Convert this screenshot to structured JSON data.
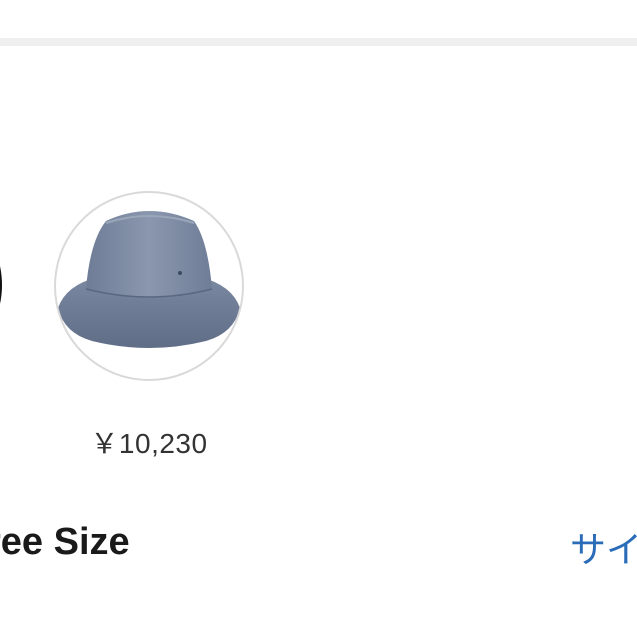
{
  "product": {
    "color_options": [
      {
        "state": "selected"
      },
      {
        "icon": "bucket-hat-icon",
        "color": "#7d8aa3",
        "price": "￥10,230"
      }
    ],
    "size": {
      "value": "ree Size",
      "guide_link": "サイ"
    }
  },
  "colors": {
    "link": "#2b6cb8",
    "hat_blue_gray": "#7d8aa3",
    "selected_ring": "#111111"
  }
}
